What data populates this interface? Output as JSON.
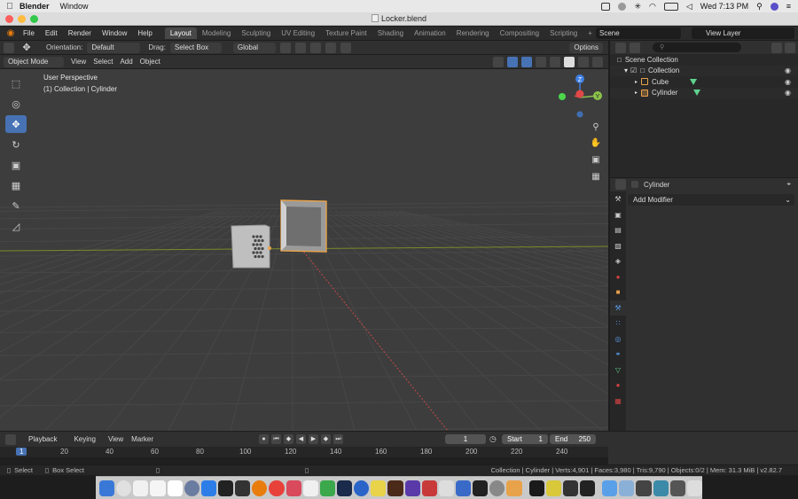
{
  "mac_menubar": {
    "app_name": "Blender",
    "menu": [
      "Window"
    ],
    "clock": "Wed 7:13 PM"
  },
  "window": {
    "title": "Locker.blend"
  },
  "topbar": {
    "menus": [
      "File",
      "Edit",
      "Render",
      "Window",
      "Help"
    ],
    "workspaces": [
      "Layout",
      "Modeling",
      "Sculpting",
      "UV Editing",
      "Texture Paint",
      "Shading",
      "Animation",
      "Rendering",
      "Compositing",
      "Scripting"
    ],
    "active_workspace": "Layout",
    "add_tab": "+",
    "scene": "Scene",
    "view_layer": "View Layer"
  },
  "header1": {
    "orientation_label": "Orientation:",
    "orientation_value": "Default",
    "drag_label": "Drag:",
    "drag_value": "Select Box",
    "transform_value": "Global",
    "options": "Options"
  },
  "header2": {
    "mode": "Object Mode",
    "menus": [
      "View",
      "Select",
      "Add",
      "Object"
    ]
  },
  "viewport": {
    "perspective": "User Perspective",
    "collection_info": "(1) Collection | Cylinder",
    "gizmo_z": "Z",
    "gizmo_y": "Y"
  },
  "outliner": {
    "items": [
      {
        "label": "Scene Collection",
        "level": 0
      },
      {
        "label": "Collection",
        "level": 1
      },
      {
        "label": "Cube",
        "level": 2
      },
      {
        "label": "Cylinder",
        "level": 2
      }
    ]
  },
  "properties": {
    "object_name": "Cylinder",
    "add_modifier": "Add Modifier"
  },
  "timeline": {
    "menus": [
      "Playback",
      "Keying",
      "View",
      "Marker"
    ],
    "current_frame": "1",
    "start_label": "Start",
    "start_value": "1",
    "end_label": "End",
    "end_value": "250",
    "ticks": [
      "1",
      "20",
      "40",
      "60",
      "80",
      "100",
      "120",
      "140",
      "160",
      "180",
      "200",
      "220",
      "240"
    ]
  },
  "statusbar": {
    "select": "Select",
    "box_select": "Box Select",
    "stats": "Collection | Cylinder | Verts:4,901 | Faces:3,980 | Tris:9,790 | Objects:0/2 | Mem: 31.3 MiB | v2.82.7"
  },
  "colors": {
    "accent_blue": "#4772b3",
    "orange": "#e87d0d",
    "viewport_bg": "#3d3d3d",
    "panel_bg": "#303030"
  }
}
